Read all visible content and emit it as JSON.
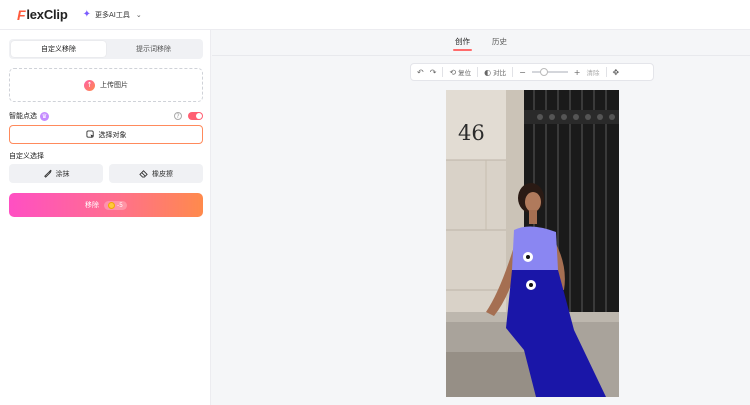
{
  "header": {
    "logo_mark": "F",
    "logo_text": "lexClip",
    "more_ai": "更多AI工具"
  },
  "left_panel": {
    "tabs": [
      {
        "label": "自定义移除",
        "active": true
      },
      {
        "label": "提示词移除",
        "active": false
      }
    ],
    "upload_label": "上传图片",
    "smart_select_label": "智能点选",
    "smart_select_on": true,
    "select_object_label": "选择对象",
    "custom_select_label": "自定义选择",
    "tools": {
      "brush_label": "涂抹",
      "eraser_label": "橡皮擦"
    },
    "remove_button_label": "移除",
    "remove_cost": "-5"
  },
  "main": {
    "tabs": [
      {
        "label": "创作",
        "active": true
      },
      {
        "label": "历史",
        "active": false
      }
    ],
    "toolbar": {
      "reset_label": "复位",
      "compare_label": "对比",
      "clear_label": "清除"
    },
    "brush_size_level": 0.3,
    "photo": {
      "house_number": "46"
    }
  },
  "colors": {
    "accent_gradient_start": "#ff4fc3",
    "accent_gradient_end": "#ff8a4c",
    "selection_upper": "#8a86f2",
    "selection_lower": "#1a16a8",
    "active_tab_underline": "#ff6b6b"
  }
}
